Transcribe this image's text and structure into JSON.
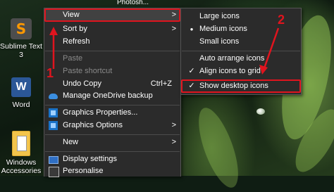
{
  "desktop": {
    "top_file_label": "Photosh...",
    "icons": [
      {
        "label": "Sublime Text 3",
        "icon": "sublime-text-icon"
      },
      {
        "label": "Word",
        "icon": "word-icon"
      },
      {
        "label": "Windows Accessories",
        "icon": "folder-icon"
      }
    ]
  },
  "context_menu": {
    "items": [
      {
        "label": "View",
        "has_submenu": true,
        "highlighted": true
      },
      {
        "label": "Sort by",
        "has_submenu": true
      },
      {
        "label": "Refresh"
      },
      {
        "label": "Paste",
        "disabled": true
      },
      {
        "label": "Paste shortcut",
        "disabled": true
      },
      {
        "label": "Undo Copy",
        "shortcut": "Ctrl+Z"
      },
      {
        "label": "Manage OneDrive backup",
        "icon": "onedrive-icon"
      },
      {
        "label": "Graphics Properties...",
        "icon": "intel-graphics-icon"
      },
      {
        "label": "Graphics Options",
        "icon": "intel-graphics-icon",
        "has_submenu": true
      },
      {
        "label": "New",
        "has_submenu": true
      },
      {
        "label": "Display settings",
        "icon": "display-icon"
      },
      {
        "label": "Personalise",
        "icon": "personalise-icon"
      }
    ]
  },
  "view_submenu": {
    "items": [
      {
        "label": "Large icons"
      },
      {
        "label": "Medium icons",
        "selected_mark": "●"
      },
      {
        "label": "Small icons"
      },
      {
        "label": "Auto arrange icons"
      },
      {
        "label": "Align icons to grid",
        "check_mark": "✓"
      },
      {
        "label": "Show desktop icons",
        "check_mark": "✓",
        "highlighted": true
      }
    ]
  },
  "annotations": {
    "step1": "1",
    "step2": "2",
    "color": "#e0141e"
  }
}
